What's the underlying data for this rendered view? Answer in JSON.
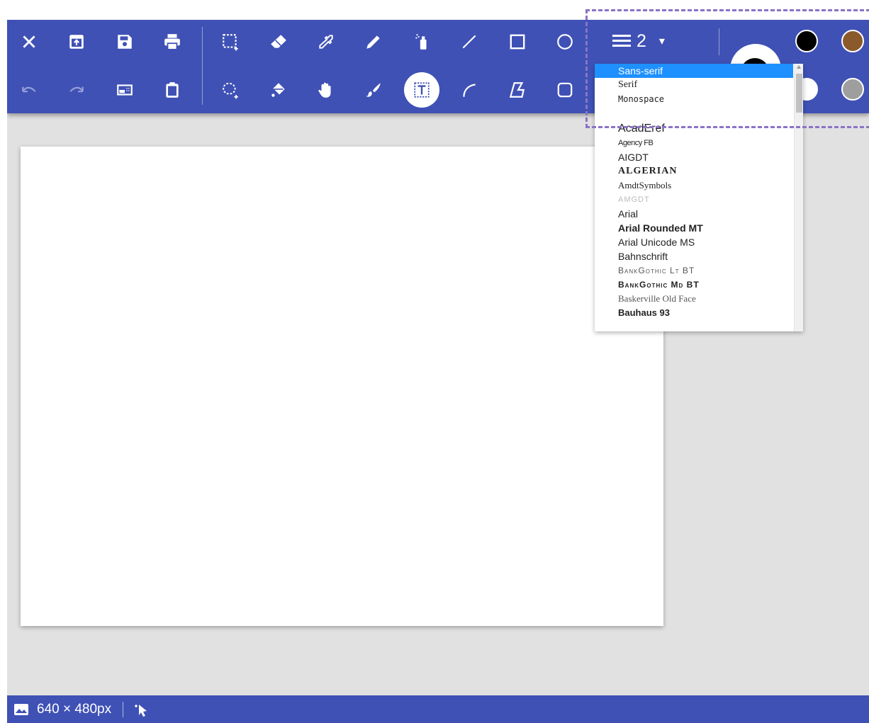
{
  "app": {
    "canvas_size_label": "640 × 480px",
    "thickness_value": "2",
    "brand_color": "#3f51b5",
    "toolbar_buttons_row1": [
      "close-icon",
      "open-icon",
      "save-icon",
      "print-icon",
      "rect-select-icon",
      "eraser-icon",
      "eyedropper-icon",
      "pencil-icon",
      "spray-icon",
      "line-icon",
      "rectangle-icon",
      "ellipse-icon"
    ],
    "toolbar_buttons_row2": [
      "undo-icon",
      "redo-icon",
      "resize-image-icon",
      "paste-icon",
      "lasso-select-icon",
      "fill-bucket-icon",
      "pan-hand-icon",
      "brush-icon",
      "text-tool-icon",
      "curve-icon",
      "polygon-icon",
      "rounded-rectangle-icon"
    ]
  },
  "colors": {
    "primary": "#000000",
    "palette_row1": [
      "#000000",
      "#8b5a2b"
    ],
    "palette_row2": [
      "#ffffff",
      "#9e9e9e"
    ]
  },
  "font_dropdown": {
    "selected": "Sans-serif",
    "items": [
      "Sans-serif",
      "Serif",
      "Monospace",
      "",
      "AcadEref",
      "Agency FB",
      "AIGDT",
      "ALGERIAN",
      "AmdtSymbols",
      "AMGDT",
      "Arial",
      "Arial Rounded MT",
      "Arial Unicode MS",
      "Bahnschrift",
      "BankGothic Lt BT",
      "BankGothic Md BT",
      "Baskerville Old Face",
      "Bauhaus 93"
    ]
  }
}
